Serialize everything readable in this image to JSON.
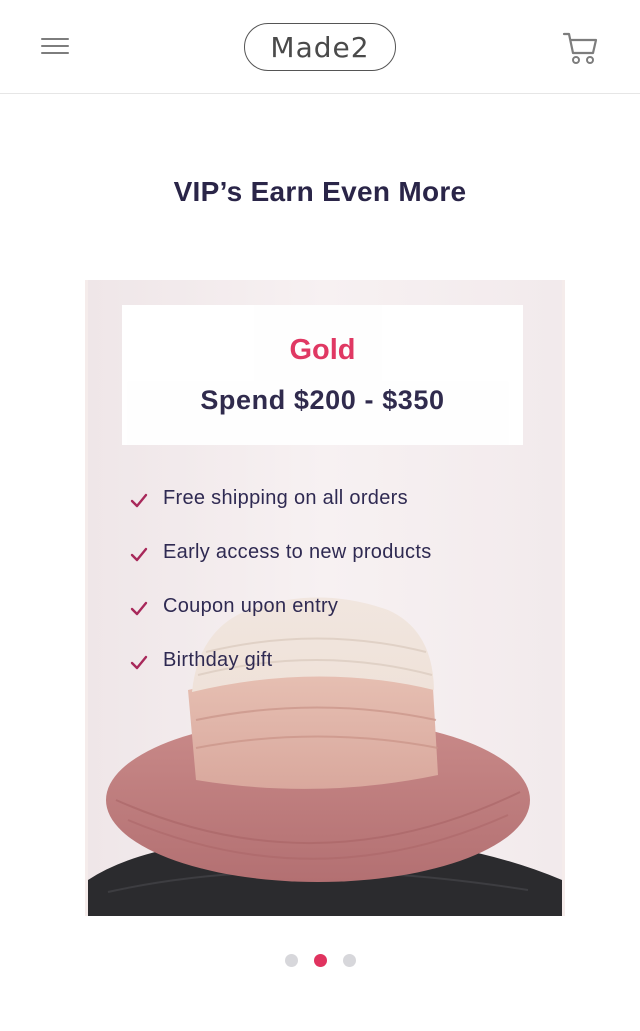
{
  "header": {
    "logo_text": "Made2",
    "menu_icon": "hamburger-menu-icon",
    "cart_icon": "shopping-cart-icon"
  },
  "main": {
    "heading": "VIP’s Earn Even More"
  },
  "tier_card": {
    "tier_name": "Gold",
    "spend_range": "Spend $200 - $350",
    "benefits": [
      "Free shipping on all orders",
      "Early access to new products",
      "Coupon upon entry",
      "Birthday gift"
    ],
    "check_icon": "checkmark-icon",
    "image_subject": "pink and cream straw sun hat"
  },
  "carousel": {
    "page_count": 3,
    "active_index": 1
  },
  "colors": {
    "accent": "#e0335f",
    "text_dark": "#2a2548",
    "card_bg": "#f5eceb"
  }
}
